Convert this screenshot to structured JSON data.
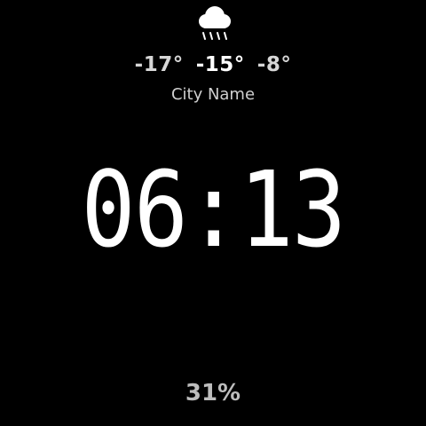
{
  "weather": {
    "icon": "rain-cloud-icon",
    "temp_low": "-17°",
    "temp_current": "-15°",
    "temp_high": "-8°",
    "city": "City Name"
  },
  "clock": {
    "time": "06:13"
  },
  "battery": {
    "level": "31%"
  },
  "colors": {
    "background": "#000000",
    "text": "#ffffff",
    "secondary_text": "#cfcfcf",
    "battery_text": "#bdbdbd"
  }
}
